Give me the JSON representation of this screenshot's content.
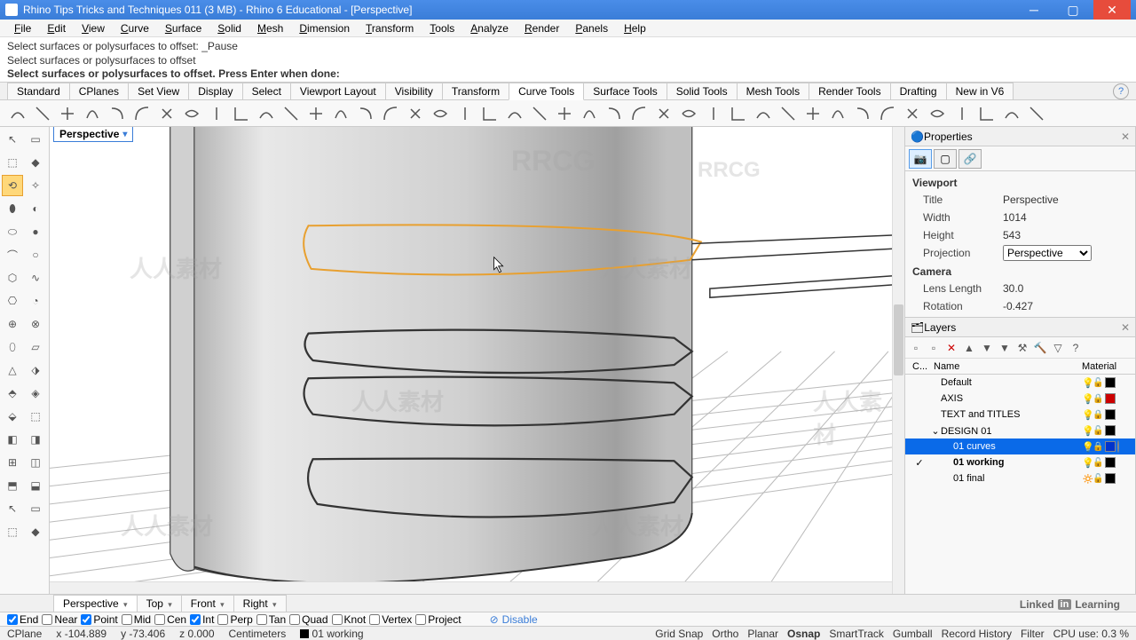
{
  "titlebar": {
    "title": "Rhino Tips Tricks and Techniques 011 (3 MB) - Rhino 6 Educational - [Perspective]"
  },
  "menu": [
    "File",
    "Edit",
    "View",
    "Curve",
    "Surface",
    "Solid",
    "Mesh",
    "Dimension",
    "Transform",
    "Tools",
    "Analyze",
    "Render",
    "Panels",
    "Help"
  ],
  "command_history": [
    "Select surfaces or polysurfaces to offset: _Pause",
    "Select surfaces or polysurfaces to offset"
  ],
  "command_prompt": "Select surfaces or polysurfaces to offset. Press Enter when done:",
  "tabs": [
    "Standard",
    "CPlanes",
    "Set View",
    "Display",
    "Select",
    "Viewport Layout",
    "Visibility",
    "Transform",
    "Curve Tools",
    "Surface Tools",
    "Solid Tools",
    "Mesh Tools",
    "Render Tools",
    "Drafting",
    "New in V6"
  ],
  "active_tab": "Curve Tools",
  "viewport": {
    "label": "Perspective"
  },
  "viewport_tabs": [
    "Perspective",
    "Top",
    "Front",
    "Right"
  ],
  "active_viewport_tab": "Perspective",
  "properties": {
    "panel_title": "Properties",
    "sections": {
      "viewport": {
        "title": "Viewport",
        "Title": "Perspective",
        "Width": "1014",
        "Height": "543",
        "Projection": "Perspective"
      },
      "camera": {
        "title": "Camera",
        "Lens Length": "30.0",
        "Rotation": "-0.427"
      }
    }
  },
  "layers": {
    "panel_title": "Layers",
    "headers": {
      "c": "C...",
      "name": "Name",
      "material": "Material"
    },
    "items": [
      {
        "name": "Default",
        "depth": 0,
        "color": "#000",
        "check": false,
        "locked": false,
        "bulbon": true
      },
      {
        "name": "AXIS",
        "depth": 0,
        "color": "#c00",
        "check": false,
        "locked": true,
        "bulbon": true
      },
      {
        "name": "TEXT and TITLES",
        "depth": 0,
        "color": "#000",
        "check": false,
        "locked": true,
        "bulbon": true
      },
      {
        "name": "DESIGN 01",
        "depth": 0,
        "color": "#000",
        "check": false,
        "expand": true,
        "locked": false,
        "bulbon": true
      },
      {
        "name": "01 curves",
        "depth": 1,
        "color": "#0033cc",
        "check": false,
        "selected": true,
        "locked": true,
        "bulbon": true,
        "mat": true
      },
      {
        "name": "01 working",
        "depth": 1,
        "color": "#000",
        "check": true,
        "bold": true,
        "locked": false,
        "bulbon": true
      },
      {
        "name": "01 final",
        "depth": 1,
        "color": "#000",
        "check": false,
        "locked": false,
        "bulbon": false
      }
    ]
  },
  "snaps": [
    {
      "label": "End",
      "on": true
    },
    {
      "label": "Near",
      "on": false
    },
    {
      "label": "Point",
      "on": true
    },
    {
      "label": "Mid",
      "on": false
    },
    {
      "label": "Cen",
      "on": false
    },
    {
      "label": "Int",
      "on": true
    },
    {
      "label": "Perp",
      "on": false
    },
    {
      "label": "Tan",
      "on": false
    },
    {
      "label": "Quad",
      "on": false
    },
    {
      "label": "Knot",
      "on": false
    },
    {
      "label": "Vertex",
      "on": false
    },
    {
      "label": "Project",
      "on": false
    }
  ],
  "snap_disable": "Disable",
  "status": {
    "cplane": "CPlane",
    "x": "x -104.889",
    "y": "y -73.406",
    "z": "z 0.000",
    "units": "Centimeters",
    "layer": "01 working",
    "right": [
      {
        "label": "Grid Snap",
        "active": false
      },
      {
        "label": "Ortho",
        "active": false
      },
      {
        "label": "Planar",
        "active": false
      },
      {
        "label": "Osnap",
        "active": true
      },
      {
        "label": "SmartTrack",
        "active": false
      },
      {
        "label": "Gumball",
        "active": false
      },
      {
        "label": "Record History",
        "active": false
      },
      {
        "label": "Filter",
        "active": false
      },
      {
        "label": "CPU use: 0.3 %",
        "active": false
      }
    ]
  },
  "watermarks": [
    "RRCG",
    "人人素材"
  ],
  "linkedin": "Linked in Learning"
}
